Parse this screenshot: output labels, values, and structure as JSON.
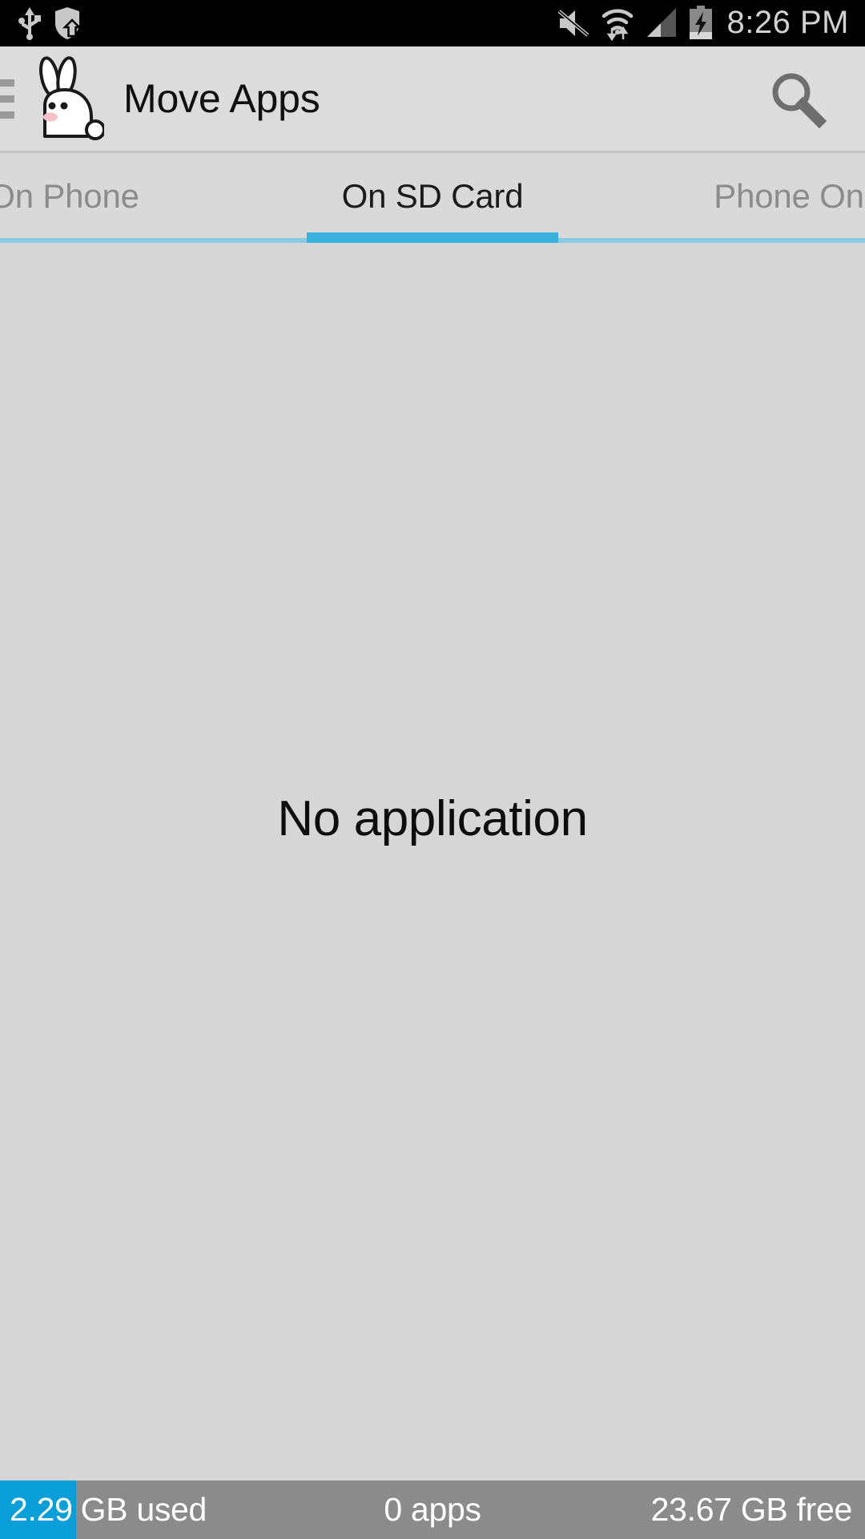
{
  "status_bar": {
    "icons": [
      "usb-icon",
      "shield-security-icon",
      "mute-icon",
      "wifi-transfer-icon",
      "cell-signal-icon",
      "battery-charging-icon"
    ],
    "time": "8:26 PM",
    "background": "#000000",
    "icon_color": "#c8c8c8"
  },
  "app_bar": {
    "menu_icon": "hamburger-menu-icon",
    "app_icon": "rabbit-icon",
    "title": "Move Apps",
    "search_icon": "search-icon",
    "background": "#dcdcdc"
  },
  "tabs": {
    "items": [
      {
        "label": "On Phone",
        "active": false
      },
      {
        "label": "On SD Card",
        "active": true
      },
      {
        "label": "Phone Only",
        "active": false
      }
    ],
    "active_index": 1,
    "indicator_color": "#38b0de",
    "track_color": "#89c9e3"
  },
  "content": {
    "empty_message": "No application"
  },
  "bottom_bar": {
    "used_value": "2.29",
    "used_label": "GB used",
    "app_count": "0 apps",
    "free_space": "23.67 GB free",
    "fill_color": "#0a9fd8",
    "background": "#8b8b8b"
  }
}
